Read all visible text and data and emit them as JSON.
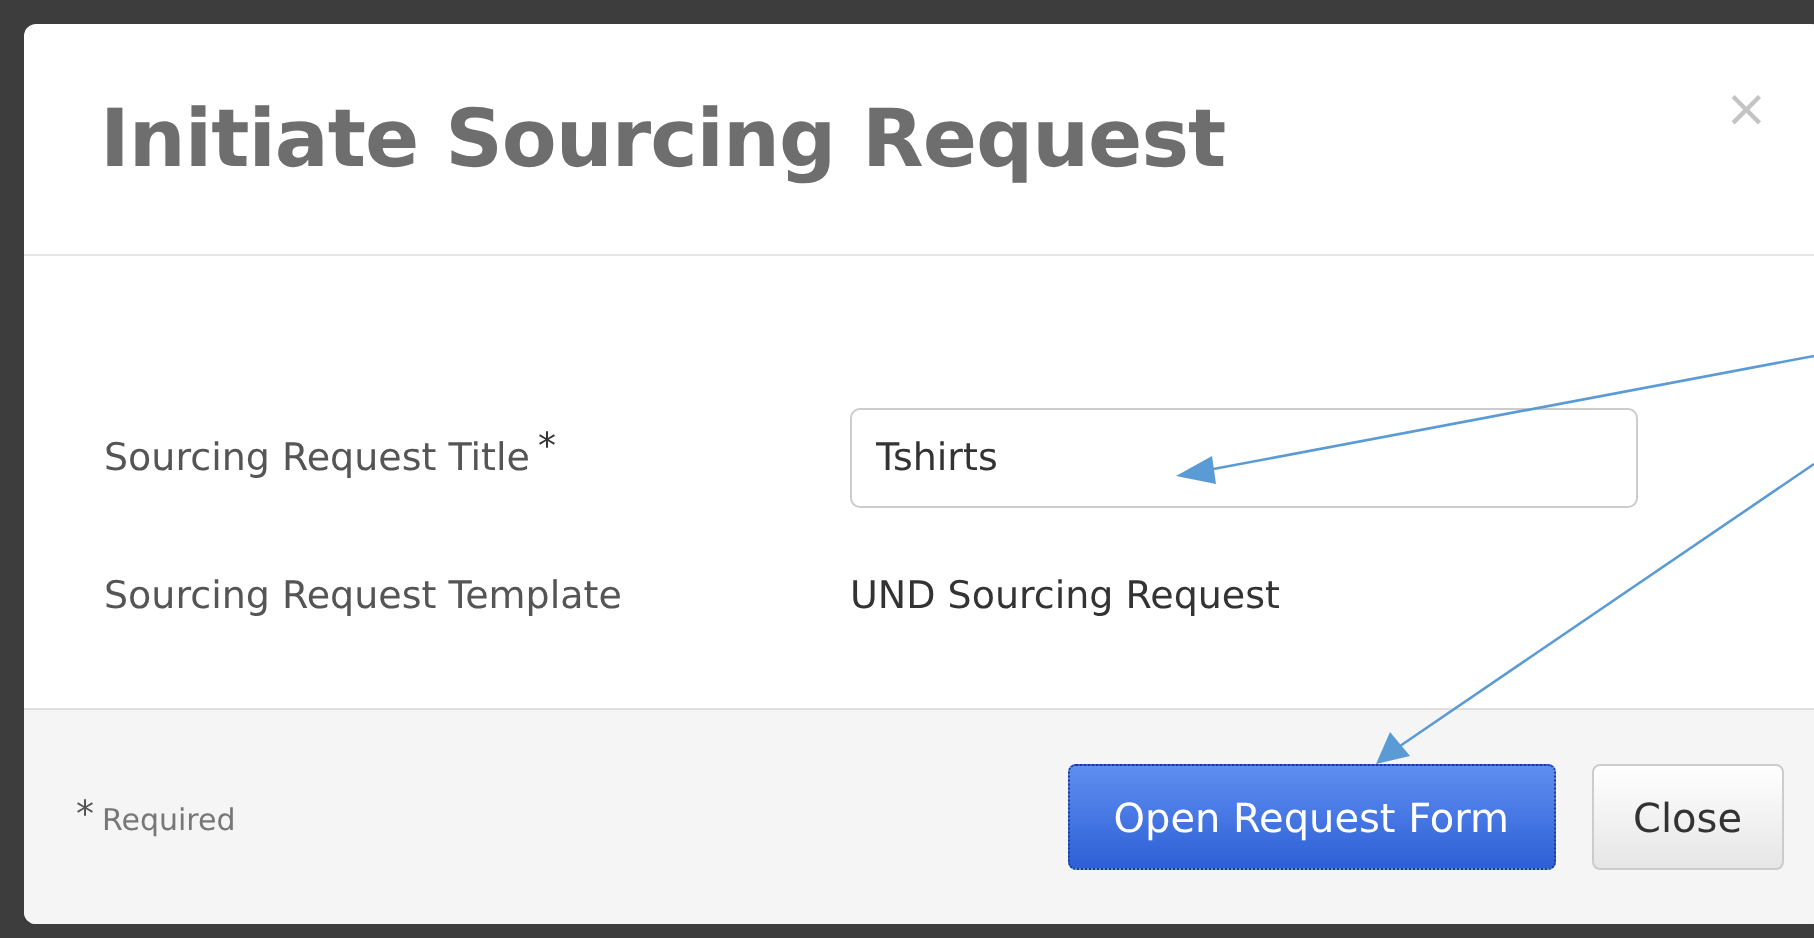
{
  "dialog": {
    "title": "Initiate Sourcing Request",
    "close_glyph": "×"
  },
  "fields": [
    {
      "kind": "input",
      "label": "Sourcing Request Title",
      "required_mark": "*",
      "value": "Tshirts"
    },
    {
      "kind": "static",
      "label": "Sourcing Request Template",
      "value": "UND Sourcing Request"
    }
  ],
  "footer": {
    "required_mark": "*",
    "required_note": "Required",
    "buttons": [
      {
        "label": "Open Request Form",
        "primary": true
      },
      {
        "label": "Close",
        "primary": false
      }
    ]
  }
}
